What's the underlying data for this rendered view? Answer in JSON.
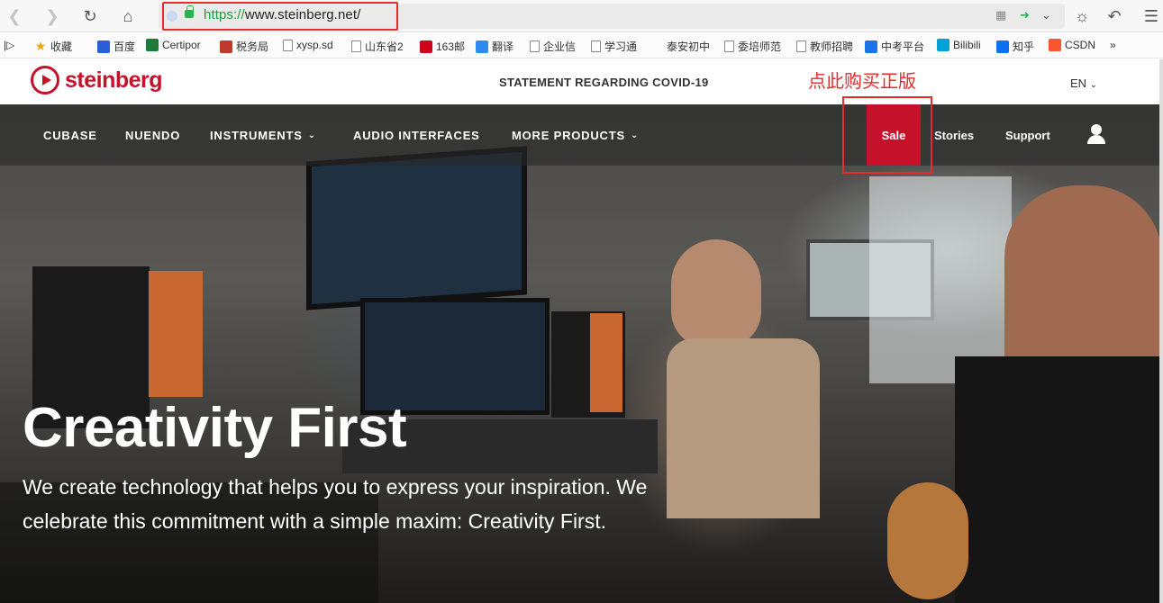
{
  "browser": {
    "url_scheme": "https://",
    "url_rest": "www.steinberg.net/",
    "bookmarks": [
      {
        "label": "收藏",
        "icon": "star-icon",
        "color": "#f0a30a"
      },
      {
        "label": "百度",
        "icon": "baidu-icon",
        "color": "#2b5fd9"
      },
      {
        "label": "Certipor",
        "icon": "certiport-icon",
        "color": "#1d7a3a"
      },
      {
        "label": "税务局",
        "icon": "tax-icon",
        "color": "#c0392b"
      },
      {
        "label": "xysp.sd",
        "icon": "page-icon",
        "color": "#888888"
      },
      {
        "label": "山东省2",
        "icon": "page-icon",
        "color": "#888888"
      },
      {
        "label": "163邮",
        "icon": "mail-163-icon",
        "color": "#d0021b"
      },
      {
        "label": "翻译",
        "icon": "translate-icon",
        "color": "#2d8cf0"
      },
      {
        "label": "企业信",
        "icon": "page-icon",
        "color": "#888888"
      },
      {
        "label": "学习通",
        "icon": "page-icon",
        "color": "#888888"
      },
      {
        "label": "泰安初中",
        "icon": "none",
        "color": "#888888"
      },
      {
        "label": "委培师范",
        "icon": "page-icon",
        "color": "#888888"
      },
      {
        "label": "教师招聘",
        "icon": "page-icon",
        "color": "#888888"
      },
      {
        "label": "中考平台",
        "icon": "edu-icon",
        "color": "#1a73e8"
      },
      {
        "label": "Bilibili",
        "icon": "bilibili-icon",
        "color": "#00a1d6"
      },
      {
        "label": "知乎",
        "icon": "zhihu-icon",
        "color": "#0e6ff3"
      },
      {
        "label": "CSDN",
        "icon": "csdn-icon",
        "color": "#fc5531"
      }
    ],
    "more": "»"
  },
  "site": {
    "brand": "steinberg",
    "covid_notice": "STATEMENT REGARDING COVID-19",
    "annotation": "点此购买正版",
    "language": "EN",
    "nav": [
      {
        "label": "CUBASE",
        "dropdown": false
      },
      {
        "label": "NUENDO",
        "dropdown": false
      },
      {
        "label": "INSTRUMENTS",
        "dropdown": true
      },
      {
        "label": "AUDIO INTERFACES",
        "dropdown": false
      },
      {
        "label": "MORE PRODUCTS",
        "dropdown": true
      }
    ],
    "sale": "Sale",
    "stories": "Stories",
    "support": "Support",
    "hero_title": "Creativity First",
    "hero_subtitle": "We create technology that helps you to express your inspiration. We celebrate this commitment with a simple maxim: Creativity First.",
    "accent_color": "#c6112b"
  }
}
